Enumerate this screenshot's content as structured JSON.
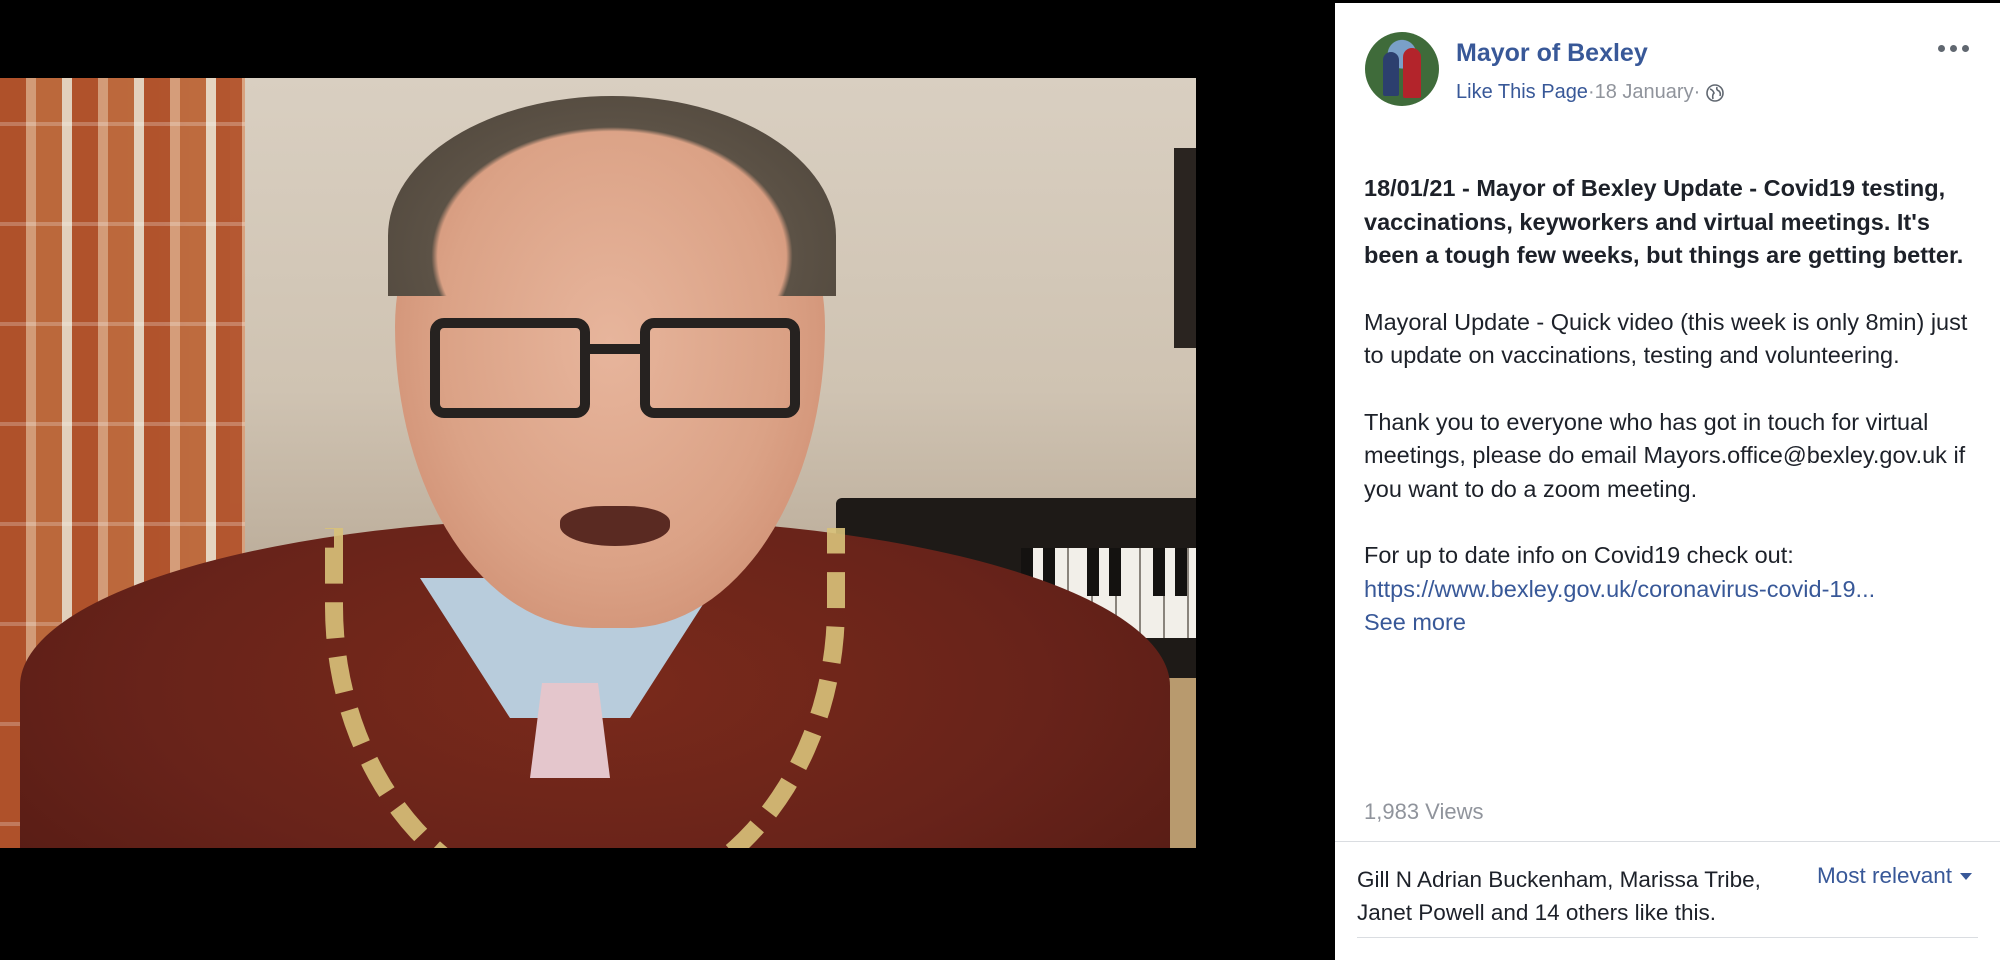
{
  "video": {
    "description_hidden": ""
  },
  "post": {
    "page_name": "Mayor of Bexley",
    "like_link": "Like This Page",
    "separator": " · ",
    "date": "18 January",
    "separator2": " · ",
    "privacy_icon": "globe-icon",
    "headline": "18/01/21 - Mayor of Bexley Update - Covid19 testing, vaccinations, keyworkers and virtual meetings. It's been a tough few weeks, but things are getting better.",
    "paragraph1": "Mayoral Update - Quick video (this week is only 8min) just to update on vaccinations, testing and volunteering.",
    "paragraph2": "Thank you to everyone who has got in touch for virtual meetings, please do email Mayors.office@bexley.gov.uk if you want to do a zoom meeting.",
    "paragraph3_text": "For up to date info on Covid19 check out:",
    "paragraph3_link": "https://www.bexley.gov.uk/coronavirus-covid-19...",
    "see_more": "See more",
    "views": "1,983 Views"
  },
  "reactions": {
    "likes_text": "Gill N Adrian Buckenham, Marissa Tribe, Janet Powell and 14 others like this.",
    "sort_label": "Most relevant"
  },
  "colors": {
    "link": "#385898",
    "muted": "#90949c",
    "text": "#1d2129",
    "video_bg": "#000000"
  }
}
